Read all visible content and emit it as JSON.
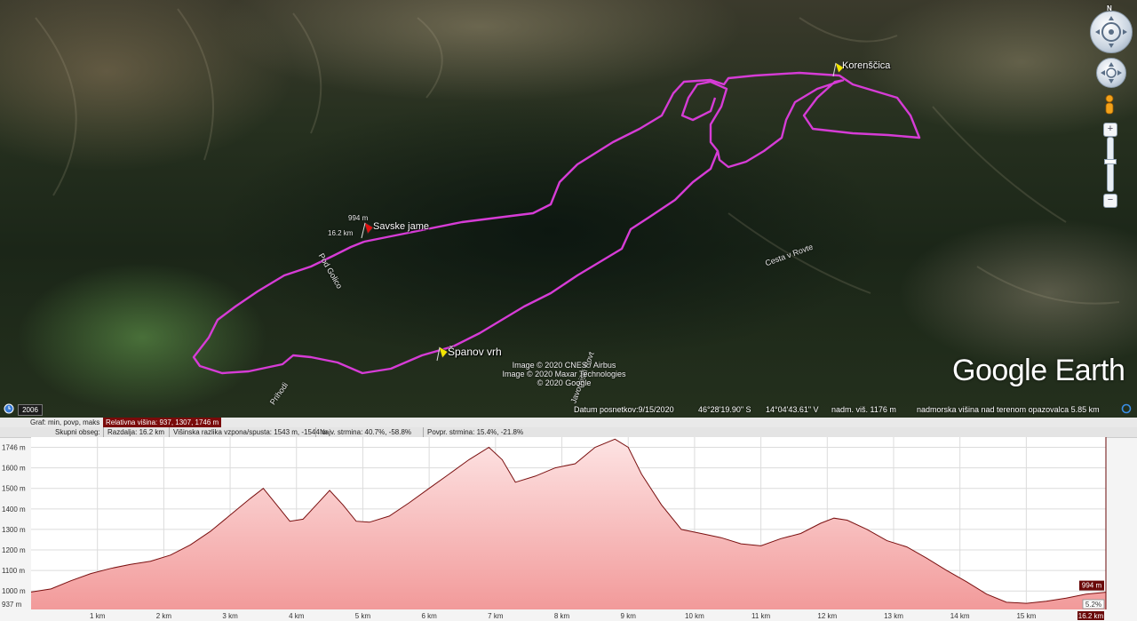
{
  "map": {
    "places": [
      {
        "name": "Korenščica"
      },
      {
        "name": "Savske jame"
      },
      {
        "name": "Španov vrh"
      }
    ],
    "roads": [
      {
        "name": "Pod Golico"
      },
      {
        "name": "Cesta v Rovte"
      },
      {
        "name": "Prihodi"
      },
      {
        "name": "Javorniški Rovt"
      }
    ],
    "marker_labels": {
      "elev": "994 m",
      "dist": "16.2 km"
    },
    "copyright": [
      "Image © 2020 CNES / Airbus",
      "Image © 2020 Maxar Technologies",
      "© 2020 Google"
    ],
    "logo": "Google Earth",
    "year": "2006",
    "status": {
      "date": "Datum posnetkov:9/15/2020",
      "lat": "46°28'19.90\" S",
      "lon": "14°04'43.61\" V",
      "elev": "nadm. viš.  1176 m",
      "eye": "nadmorska višina nad terenom opazovalca   5.85 km"
    },
    "compass_label": "N",
    "track_color": "#d63cd6",
    "pin_color_yellow": "#f2e600",
    "pin_color_red": "#e01010"
  },
  "profile": {
    "graph_label": "Graf: min, povp, maks",
    "graph_value": "Relativna višina: 937, 1307, 1746 m",
    "overall_label": "Skupni obseg:",
    "distance": "Razdalja: 16.2 km",
    "elev_diff": "Višinska razlika vzpona/spusta: 1543 m, -1544 m",
    "max_slope": "Najv. strmina: 40.7%, -58.8%",
    "avg_slope": "Povpr. strmina: 15.4%, -21.8%",
    "current_elev": "994 m",
    "current_slope": "5.2%",
    "current_dist": "16.2 km"
  },
  "chart_data": {
    "type": "area",
    "title": "",
    "xlabel": "",
    "ylabel": "",
    "ylim": [
      910,
      1750
    ],
    "xlim": [
      0,
      16.2
    ],
    "y_ticks": [
      1000,
      1100,
      1200,
      1300,
      1400,
      1500,
      1600,
      1700
    ],
    "y_ticks_labels": [
      "1000 m",
      "1100 m",
      "1200 m",
      "1300 m",
      "1400 m",
      "1500 m",
      "1600 m",
      "1746 m"
    ],
    "y_min_label": "937 m",
    "x_ticks": [
      1,
      2,
      3,
      4,
      5,
      6,
      7,
      8,
      9,
      10,
      11,
      12,
      13,
      14,
      15
    ],
    "x_ticks_labels": [
      "1 km",
      "2 km",
      "3 km",
      "4 km",
      "5 km",
      "6 km",
      "7 km",
      "8 km",
      "9 km",
      "10 km",
      "11 km",
      "12 km",
      "13 km",
      "14 km",
      "15 km"
    ],
    "grid": true,
    "fill_color": "#f7c7c7",
    "line_color": "#7a1010",
    "x": [
      0,
      0.3,
      0.6,
      0.9,
      1.2,
      1.5,
      1.8,
      2.1,
      2.4,
      2.7,
      3.0,
      3.3,
      3.5,
      3.7,
      3.9,
      4.1,
      4.3,
      4.5,
      4.7,
      4.9,
      5.1,
      5.4,
      5.7,
      6.0,
      6.3,
      6.6,
      6.9,
      7.1,
      7.3,
      7.6,
      7.9,
      8.2,
      8.5,
      8.8,
      9.0,
      9.2,
      9.5,
      9.8,
      10.1,
      10.4,
      10.7,
      11.0,
      11.3,
      11.6,
      11.9,
      12.1,
      12.3,
      12.6,
      12.9,
      13.2,
      13.5,
      13.8,
      14.1,
      14.4,
      14.7,
      15.0,
      15.3,
      15.6,
      15.9,
      16.2
    ],
    "y": [
      995,
      1010,
      1050,
      1085,
      1110,
      1130,
      1145,
      1175,
      1225,
      1290,
      1370,
      1450,
      1500,
      1420,
      1340,
      1350,
      1420,
      1490,
      1420,
      1340,
      1335,
      1365,
      1430,
      1500,
      1570,
      1640,
      1700,
      1640,
      1530,
      1560,
      1600,
      1620,
      1700,
      1740,
      1700,
      1570,
      1420,
      1300,
      1280,
      1260,
      1230,
      1220,
      1255,
      1280,
      1330,
      1355,
      1345,
      1300,
      1245,
      1215,
      1160,
      1100,
      1045,
      985,
      945,
      940,
      950,
      965,
      985,
      994
    ]
  }
}
